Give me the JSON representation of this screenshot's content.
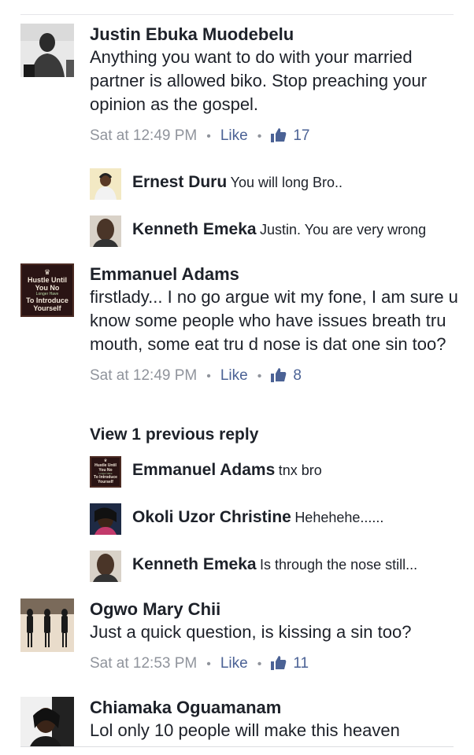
{
  "comments": [
    {
      "author": "Justin Ebuka Muodebelu",
      "text": "Anything you want to do with your married partner is allowed biko.  Stop preaching your opinion as the gospel.",
      "time": "Sat at 12:49 PM",
      "like_label": "Like",
      "likes": "17"
    },
    {
      "author": "Emmanuel Adams",
      "text": "firstlady... I no go argue wit my fone, I am sure u know some people who have issues breath tru mouth, some eat tru d nose is dat one sin too?",
      "time": "Sat at 12:49 PM",
      "like_label": "Like",
      "likes": "8",
      "avatar_text": {
        "line1": "Hustle Until",
        "line2": "You No",
        "line3": "Longer Have",
        "line4": "To Introduce",
        "line5": "Yourself"
      }
    },
    {
      "author": "Ogwo Mary Chii",
      "text": "Just a quick question, is kissing a sin too?",
      "time": "Sat at 12:53 PM",
      "like_label": "Like",
      "likes": "11"
    },
    {
      "author": "Chiamaka Oguamanam",
      "text": "Lol only 10 people will make this heaven"
    }
  ],
  "replies_1": [
    {
      "author": "Ernest Duru",
      "text": "You will long Bro.."
    },
    {
      "author": "Kenneth Emeka",
      "text": "Justin. You are very wrong"
    }
  ],
  "view_previous": "View 1 previous reply",
  "replies_2": [
    {
      "author": "Emmanuel Adams",
      "text": "tnx bro"
    },
    {
      "author": "Okoli Uzor Christine",
      "text": "Hehehehe......"
    },
    {
      "author": "Kenneth Emeka",
      "text": "Is through the nose still..."
    }
  ],
  "icons": {
    "thumb": "thumbs-up-icon",
    "separator": "•"
  },
  "colors": {
    "link": "#4b6295",
    "meta": "#90949c",
    "text": "#1d2129"
  }
}
